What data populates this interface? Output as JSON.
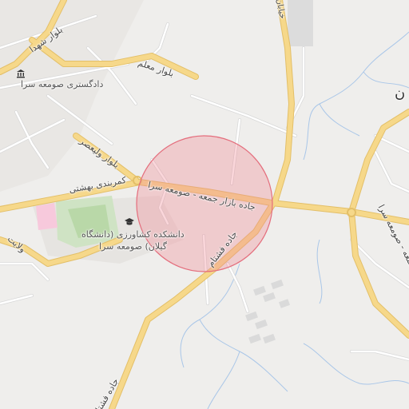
{
  "map": {
    "colors": {
      "background": "#efeeec",
      "major_road": "#f6d88a",
      "major_road_casing": "#e3bf68",
      "minor_road": "#ffffff",
      "minor_road_casing": "#d9d9d9",
      "stream": "#a9c6e8",
      "park": "#cfe3c4",
      "park_inner": "#b9d8a8",
      "pink_area": "#f7c9dc",
      "campus": "#e6e4e1",
      "buildings": "#d9d9d9",
      "radius_fill": "#f08a96",
      "radius_stroke": "#e46d7c"
    },
    "road_labels": {
      "boulevard_shohada": "بلوار شهدا",
      "boulevard_moallem": "بلوار معلم",
      "boulevard_valiasr": "بلوار ولیعصر",
      "kamarbandi_beheshti": "کمربندی بهشتی",
      "jaddeh_bazar_jomeh": "جاده بازار جمعه - صومعه سرا",
      "jaddeh_bazar_jomeh_east": "جاده بازار جمعه - صومعه سرا",
      "jaddeh_fashtam": "جاده فشتام",
      "jaddeh_fashtam_south": "جاده فشتام",
      "velayat": "ولایت",
      "top_edge_road": "خیابان"
    },
    "pois": {
      "courthouse": {
        "label": "دادگستری صومعه سرا",
        "icon": "courthouse-icon"
      },
      "university": {
        "label_line1": "دانشکده کشاورزی (دانشگاه",
        "label_line2": "گیلان) صومعه سرا",
        "icon": "graduation-cap-icon"
      }
    },
    "edge_fragment": "ن"
  }
}
